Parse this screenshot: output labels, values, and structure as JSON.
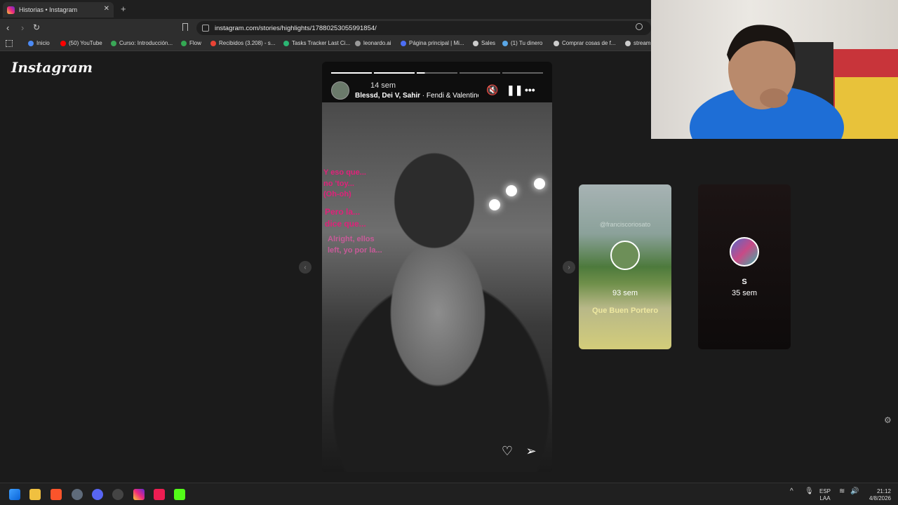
{
  "browser": {
    "tab_title": "Historias • Instagram",
    "tab_close": "✕",
    "new_tab": "+",
    "url": "instagram.com/stories/highlights/17880253055991854/",
    "bookmarks": [
      {
        "label": "Inicio",
        "color": "#4c8bf5"
      },
      {
        "label": "(50) YouTube",
        "color": "#ff0000"
      },
      {
        "label": "Curso: Introducción...",
        "color": "#3aa757"
      },
      {
        "label": "Flow",
        "color": "#34a853"
      },
      {
        "label": "Recibidos (3.208) - s...",
        "color": "#ea4335"
      },
      {
        "label": "Tasks Tracker Last Ci...",
        "color": "#2bb673"
      },
      {
        "label": "leonardo.ai",
        "color": "#999999"
      },
      {
        "label": "Página principal | Mi...",
        "color": "#4c6ef5"
      },
      {
        "label": "Sales",
        "color": "#cccccc"
      },
      {
        "label": "(1) Tu dinero",
        "color": "#5aa7e6"
      },
      {
        "label": "Comprar cosas de f...",
        "color": "#cccccc"
      },
      {
        "label": "stream",
        "color": "#cccccc"
      }
    ]
  },
  "instagram": {
    "logo": "Instagram",
    "story": {
      "time": "14 sem",
      "music_artists": "Blessd, Dei V, Sahir",
      "music_song": " · Fendi & Valentino",
      "lyrics": [
        "Y eso que...",
        "no 'toy...",
        "(Oh-oh)",
        "Pero la...",
        "dice que...",
        "Alright, ellos",
        "left, yo por la..."
      ]
    },
    "previews": [
      {
        "name": "@franciscoriosato",
        "caption": "Que Buen Portero",
        "time": "93 sem"
      },
      {
        "name": "S",
        "time": "35 sem"
      }
    ]
  },
  "taskbar": {
    "lang_top": "ESP",
    "lang_bottom": "LAA",
    "time": "21:12",
    "date": "4/8/2026"
  }
}
